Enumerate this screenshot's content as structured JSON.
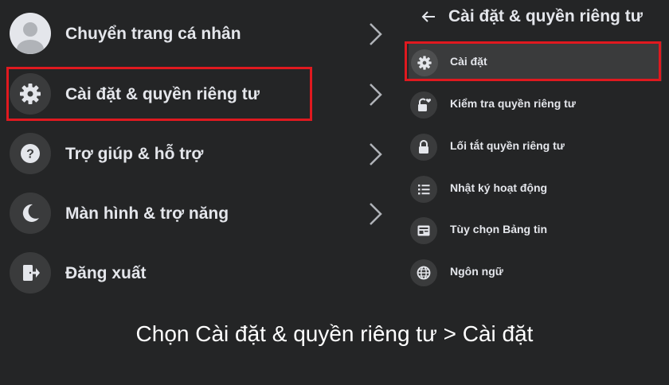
{
  "left_menu": {
    "items": [
      {
        "label": "Chuyển trang cá nhân",
        "icon": "avatar-icon"
      },
      {
        "label": "Cài đặt & quyền riêng tư",
        "icon": "gear-icon"
      },
      {
        "label": "Trợ giúp & hỗ trợ",
        "icon": "question-icon"
      },
      {
        "label": "Màn hình & trợ năng",
        "icon": "moon-icon"
      },
      {
        "label": "Đăng xuất",
        "icon": "logout-icon"
      }
    ]
  },
  "right_menu": {
    "title": "Cài đặt & quyền riêng tư",
    "items": [
      {
        "label": "Cài đặt",
        "icon": "gear-icon",
        "active": true
      },
      {
        "label": "Kiểm tra quyền riêng tư",
        "icon": "lock-heart-icon"
      },
      {
        "label": "Lối tắt quyền riêng tư",
        "icon": "lock-icon"
      },
      {
        "label": "Nhật ký hoạt động",
        "icon": "list-icon"
      },
      {
        "label": "Tùy chọn Bảng tin",
        "icon": "feed-icon"
      },
      {
        "label": "Ngôn ngữ",
        "icon": "globe-icon"
      }
    ]
  },
  "caption": "Chọn Cài đặt & quyền riêng tư > Cài đặt",
  "colors": {
    "background": "#242526",
    "icon_bg": "#3a3b3c",
    "text": "#e4e6eb",
    "highlight": "#e0191f"
  }
}
